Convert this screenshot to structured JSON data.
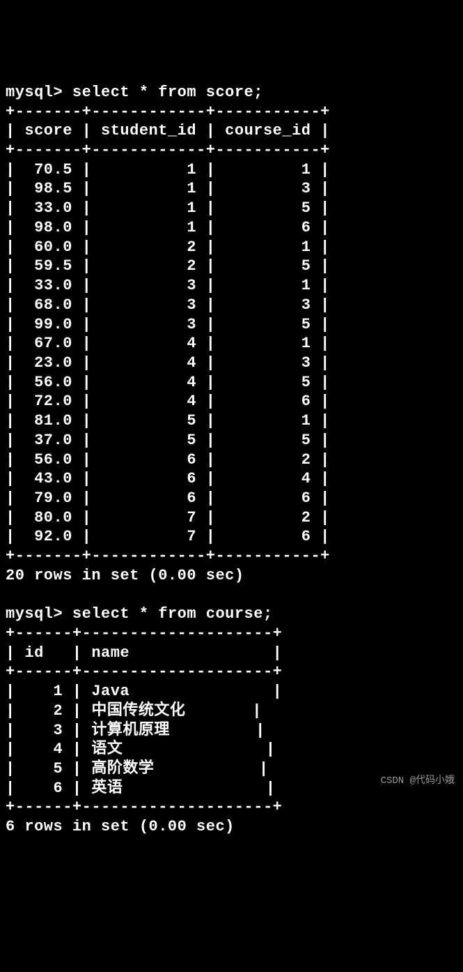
{
  "prompt": "mysql>",
  "query1": {
    "command": "select * from score;",
    "columns": [
      "score",
      "student_id",
      "course_id"
    ],
    "rows": [
      {
        "score": "70.5",
        "student_id": "1",
        "course_id": "1"
      },
      {
        "score": "98.5",
        "student_id": "1",
        "course_id": "3"
      },
      {
        "score": "33.0",
        "student_id": "1",
        "course_id": "5"
      },
      {
        "score": "98.0",
        "student_id": "1",
        "course_id": "6"
      },
      {
        "score": "60.0",
        "student_id": "2",
        "course_id": "1"
      },
      {
        "score": "59.5",
        "student_id": "2",
        "course_id": "5"
      },
      {
        "score": "33.0",
        "student_id": "3",
        "course_id": "1"
      },
      {
        "score": "68.0",
        "student_id": "3",
        "course_id": "3"
      },
      {
        "score": "99.0",
        "student_id": "3",
        "course_id": "5"
      },
      {
        "score": "67.0",
        "student_id": "4",
        "course_id": "1"
      },
      {
        "score": "23.0",
        "student_id": "4",
        "course_id": "3"
      },
      {
        "score": "56.0",
        "student_id": "4",
        "course_id": "5"
      },
      {
        "score": "72.0",
        "student_id": "4",
        "course_id": "6"
      },
      {
        "score": "81.0",
        "student_id": "5",
        "course_id": "1"
      },
      {
        "score": "37.0",
        "student_id": "5",
        "course_id": "5"
      },
      {
        "score": "56.0",
        "student_id": "6",
        "course_id": "2"
      },
      {
        "score": "43.0",
        "student_id": "6",
        "course_id": "4"
      },
      {
        "score": "79.0",
        "student_id": "6",
        "course_id": "6"
      },
      {
        "score": "80.0",
        "student_id": "7",
        "course_id": "2"
      },
      {
        "score": "92.0",
        "student_id": "7",
        "course_id": "6"
      }
    ],
    "status": "20 rows in set (0.00 sec)"
  },
  "query2": {
    "command": "select * from course;",
    "columns": [
      "id",
      "name"
    ],
    "rows": [
      {
        "id": "1",
        "name": "Java"
      },
      {
        "id": "2",
        "name": "中国传统文化"
      },
      {
        "id": "3",
        "name": "计算机原理"
      },
      {
        "id": "4",
        "name": "语文"
      },
      {
        "id": "5",
        "name": "高阶数学"
      },
      {
        "id": "6",
        "name": "英语"
      }
    ],
    "status": "6 rows in set (0.00 sec)"
  },
  "watermark": "CSDN @代码小娥"
}
